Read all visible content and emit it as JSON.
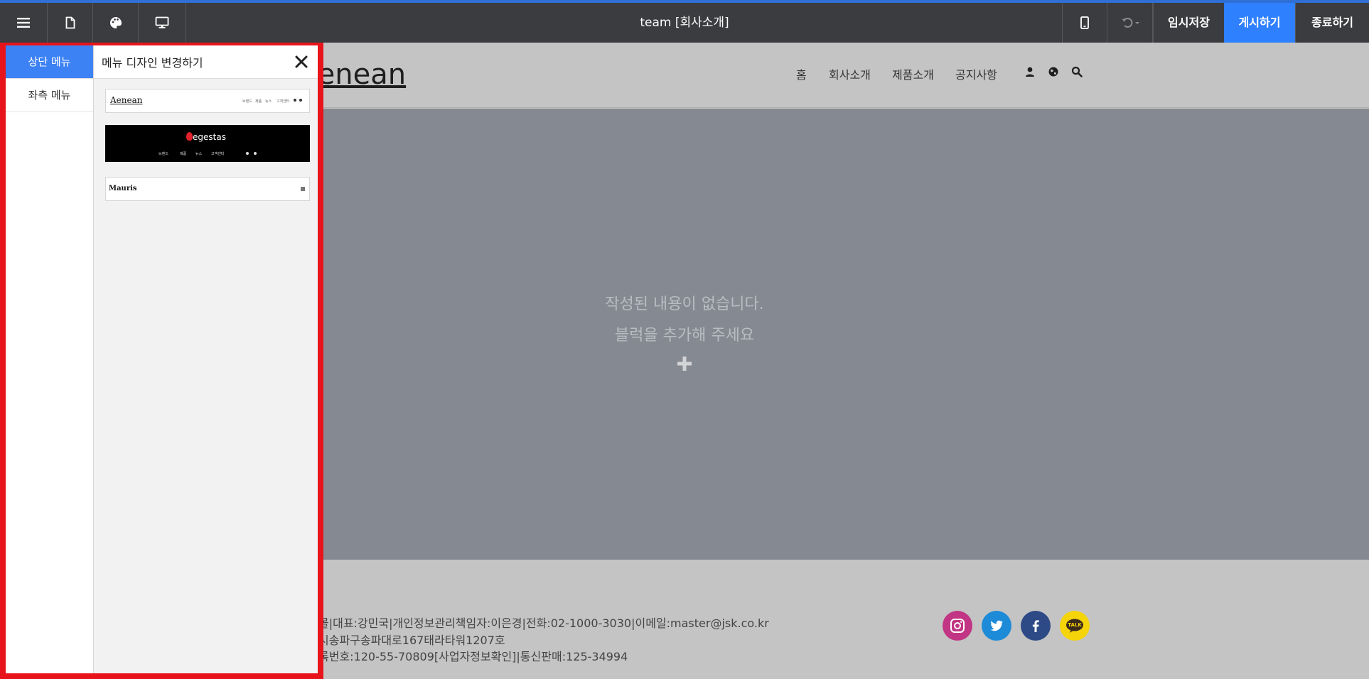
{
  "toolbar": {
    "title": "team [회사소개]",
    "icons": [
      "menu-icon",
      "page-icon",
      "palette-icon",
      "desktop-icon",
      "mobile-icon",
      "undo-icon"
    ],
    "save_draft": "임시저장",
    "publish": "게시하기",
    "exit": "종료하기",
    "accent": "#2f80ff"
  },
  "panel": {
    "tabs": [
      "상단 메뉴",
      "좌측 메뉴"
    ],
    "active_tab": 0,
    "title": "메뉴 디자인 변경하기",
    "designs": [
      {
        "logo": "Aenean",
        "menu": [
          "브랜드",
          "제품",
          "뉴스",
          "고객센터"
        ]
      },
      {
        "logo": "egestas",
        "menu": [
          "브랜드",
          "제품",
          "뉴스",
          "고객센터"
        ]
      },
      {
        "logo": "Mauris"
      }
    ],
    "highlight_color": "#e8141b"
  },
  "site": {
    "logo": "Aenean",
    "nav": [
      "홈",
      "회사소개",
      "제품소개",
      "공지사항"
    ],
    "icons": [
      "user-icon",
      "globe-icon",
      "search-icon"
    ],
    "empty_message_1": "작성된 내용이 없습니다.",
    "empty_message_2": "블럭을 추가해 주세요",
    "footer": [
      "몰|대표:강민국|개인정보관리책임자:이은경|전화:02-1000-3030|이메일:master@jsk.co.kr",
      "시송파구송파대로167태라타워1207호",
      "록번호:120-55-70809[사업자정보확인]|통신판매:125-34994"
    ],
    "social": [
      "instagram-icon",
      "twitter-icon",
      "facebook-icon",
      "kakaotalk-icon"
    ],
    "kakao_label": "TALK"
  }
}
